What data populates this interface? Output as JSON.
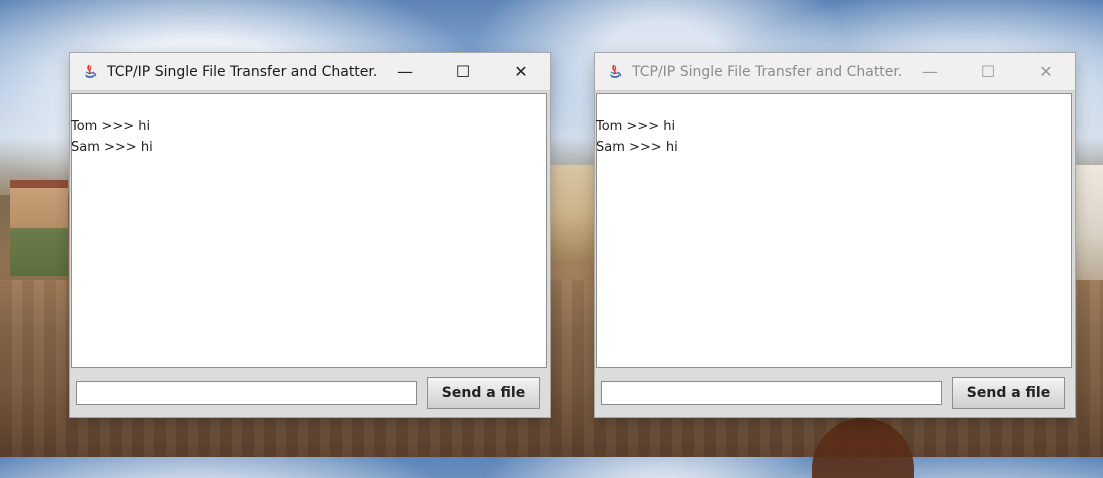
{
  "desktop": {
    "wallpaper": "cliff-town-bridge"
  },
  "windows": [
    {
      "title": "TCP/IP Single File Transfer and Chatter...",
      "active": true,
      "icon": "java-cup-icon",
      "controls": {
        "minimize": "—",
        "maximize": "☐",
        "close": "✕"
      },
      "chat_lines": [
        "Tom >>> hi",
        "Sam >>> hi"
      ],
      "input": {
        "value": "",
        "placeholder": ""
      },
      "send_button": "Send a file"
    },
    {
      "title": "TCP/IP Single File Transfer and Chatter...",
      "active": false,
      "icon": "java-cup-icon",
      "controls": {
        "minimize": "—",
        "maximize": "☐",
        "close": "✕"
      },
      "chat_lines": [
        "Tom >>> hi",
        "Sam >>> hi"
      ],
      "input": {
        "value": "",
        "placeholder": ""
      },
      "send_button": "Send a file"
    }
  ],
  "colors": {
    "titlebar": "#f0f0f0",
    "window_frame": "#d9d9d9",
    "chat_bg": "#ffffff",
    "button_text": "#222222"
  }
}
